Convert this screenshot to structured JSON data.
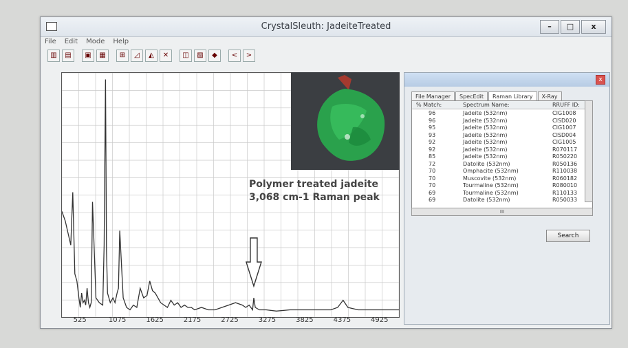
{
  "window": {
    "title": "CrystalSleuth: JadeiteTreated"
  },
  "window_buttons": {
    "minimize": "–",
    "maximize": "□",
    "close": "x"
  },
  "menu": {
    "items": [
      "File",
      "Edit",
      "Mode",
      "Help"
    ]
  },
  "toolbar": {
    "nav_prev": "<",
    "nav_next": ">"
  },
  "annotation": {
    "line1": "Polymer treated jadeite",
    "line2": "3,068 cm-1 Raman peak"
  },
  "panel": {
    "tabs": [
      "File Manager",
      "SpecEdit",
      "Raman Library",
      "X-Ray"
    ],
    "active_tab": "Raman Library",
    "columns": [
      "% Match:",
      "Spectrum Name:",
      "RRUFF ID:"
    ],
    "rows": [
      [
        "96",
        "Jadeite (532nm)",
        "CIG1008"
      ],
      [
        "96",
        "Jadeite (532nm)",
        "CISD020"
      ],
      [
        "95",
        "Jadeite (532nm)",
        "CIG1007"
      ],
      [
        "93",
        "Jadeite (532nm)",
        "CISD004"
      ],
      [
        "92",
        "Jadeite (532nm)",
        "CIG1005"
      ],
      [
        "92",
        "Jadeite (532nm)",
        "R070117"
      ],
      [
        "85",
        "Jadeite (532nm)",
        "R050220"
      ],
      [
        "72",
        "Datolite (532nm)",
        "R050136"
      ],
      [
        "70",
        "Omphacite (532nm)",
        "R110038"
      ],
      [
        "70",
        "Muscovite (532nm)",
        "R060182"
      ],
      [
        "70",
        "Tourmaline (532nm)",
        "R080010"
      ],
      [
        "69",
        "Tourmaline (532nm)",
        "R110133"
      ],
      [
        "69",
        "Datolite (532nm)",
        "R050033"
      ]
    ],
    "hscroll_label": "III",
    "search_label": "Search"
  },
  "chart_data": {
    "type": "line",
    "xlim": [
      250,
      5200
    ],
    "ylim": [
      0,
      100
    ],
    "x_ticks": [
      "525",
      "1075",
      "1625",
      "2175",
      "2725",
      "3275",
      "3825",
      "4375",
      "4925"
    ],
    "grid": true,
    "series": [
      {
        "x": [
          250,
          300,
          340,
          380,
          410,
          440,
          470,
          500,
          520,
          540,
          560,
          580,
          600,
          620,
          640,
          660,
          680,
          700,
          750,
          800,
          850,
          870,
          890,
          905,
          920,
          940,
          960,
          980,
          1000,
          1030,
          1060,
          1080,
          1100,
          1150,
          1200,
          1250,
          1300,
          1350,
          1400,
          1450,
          1500,
          1540,
          1580,
          1620,
          1660,
          1700,
          1750,
          1800,
          1850,
          1900,
          1950,
          2000,
          2050,
          2100,
          2150,
          2200,
          2300,
          2400,
          2500,
          2600,
          2700,
          2800,
          2900,
          2950,
          3000,
          3050,
          3068,
          3090,
          3150,
          3250,
          3400,
          3600,
          3800,
          4000,
          4200,
          4300,
          4380,
          4450,
          4600,
          4800,
          5000,
          5200
        ],
        "y": [
          44,
          40,
          35,
          30,
          52,
          18,
          15,
          8,
          4,
          10,
          6,
          7,
          5,
          12,
          6,
          4,
          6,
          48,
          8,
          6,
          5,
          30,
          99,
          28,
          10,
          8,
          6,
          7,
          8,
          6,
          10,
          12,
          36,
          8,
          4,
          3,
          5,
          4,
          12,
          8,
          9,
          15,
          11,
          10,
          8,
          6,
          5,
          4,
          7,
          5,
          6,
          4,
          5,
          4,
          4,
          3,
          4,
          3,
          3,
          4,
          5,
          6,
          5,
          4,
          5,
          3,
          8,
          4,
          3,
          3,
          2.5,
          3,
          3,
          3,
          3,
          4,
          7,
          4,
          3,
          3,
          3,
          3
        ]
      }
    ]
  }
}
